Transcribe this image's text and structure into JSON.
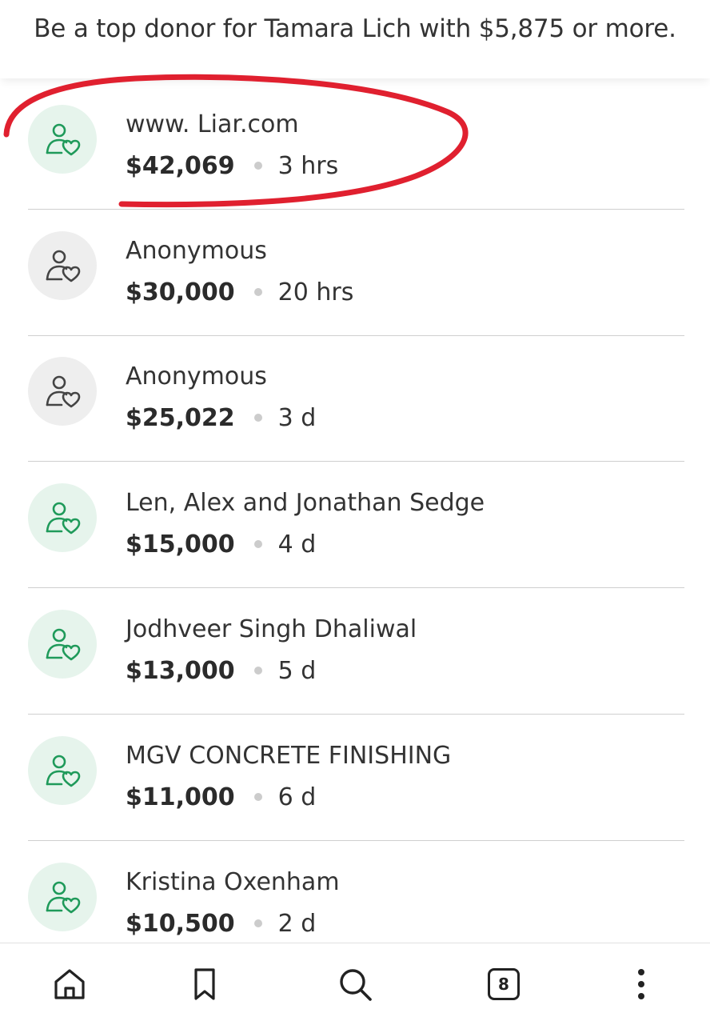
{
  "banner": {
    "text": "Be a top donor for Tamara Lich with $5,875 or more."
  },
  "donors": [
    {
      "name": "www. Liar.com",
      "amount": "$42,069",
      "time": "3 hrs",
      "avatar_style": "green"
    },
    {
      "name": "Anonymous",
      "amount": "$30,000",
      "time": "20 hrs",
      "avatar_style": "gray"
    },
    {
      "name": "Anonymous",
      "amount": "$25,022",
      "time": "3 d",
      "avatar_style": "gray"
    },
    {
      "name": "Len, Alex and Jonathan Sedge",
      "amount": "$15,000",
      "time": "4 d",
      "avatar_style": "green"
    },
    {
      "name": "Jodhveer Singh Dhaliwal",
      "amount": "$13,000",
      "time": "5 d",
      "avatar_style": "green"
    },
    {
      "name": "MGV CONCRETE FINISHING",
      "amount": "$11,000",
      "time": "6 d",
      "avatar_style": "green"
    },
    {
      "name": "Kristina Oxenham",
      "amount": "$10,500",
      "time": "2 d",
      "avatar_style": "green"
    }
  ],
  "annotation": {
    "shape": "hand-drawn-ellipse",
    "color": "#e0202f"
  },
  "bottom_nav": {
    "items": [
      "home-icon",
      "bookmark-icon",
      "search-icon",
      "tabs-icon",
      "more-icon"
    ],
    "tab_count": "8"
  },
  "colors": {
    "green_icon": "#1f9a5a",
    "green_avatar_bg": "#e6f4ec",
    "gray_icon": "#444444",
    "gray_avatar_bg": "#eeeeee",
    "annotation": "#e0202f"
  }
}
